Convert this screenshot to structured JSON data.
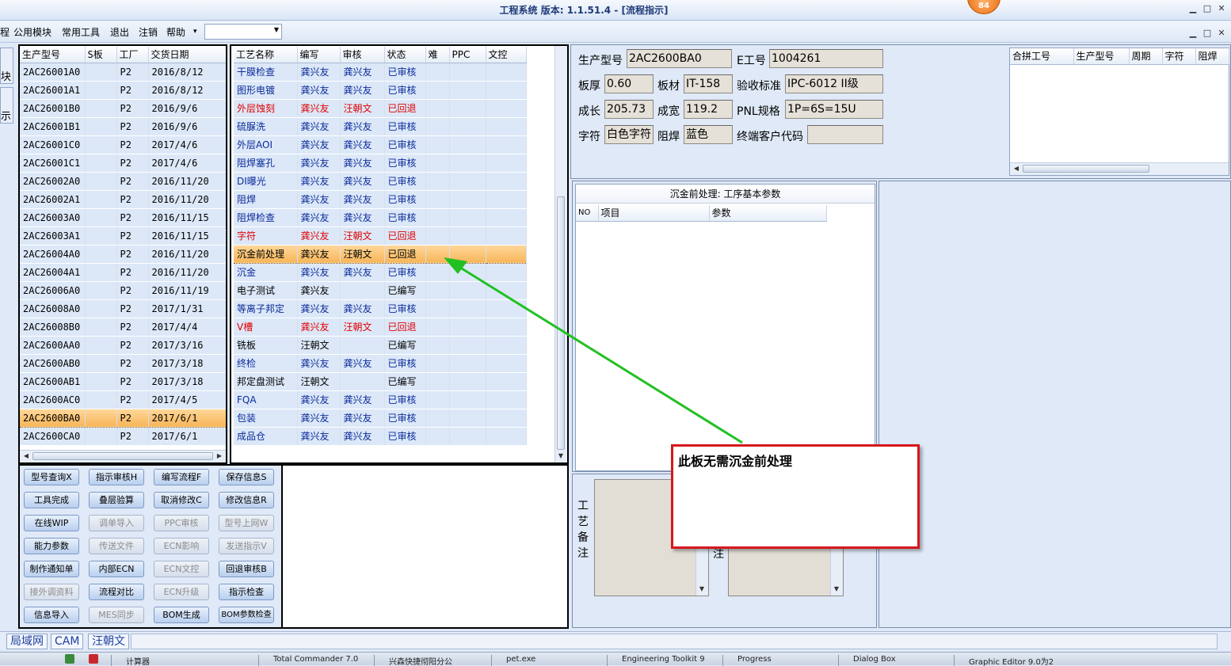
{
  "window": {
    "title": "工程系统  版本: 1.1.51.4 - [流程指示]",
    "badge": "84",
    "min_label": "▁",
    "max_label": "□",
    "close_label": "✕"
  },
  "menu": {
    "items": [
      "程",
      "公用模块",
      "常用工具",
      "退出",
      "注销",
      "帮助"
    ],
    "help_arrow": "▾"
  },
  "left_tabs": [
    "块",
    "示"
  ],
  "product_list": {
    "columns": [
      "生产型号",
      "S板",
      "工厂",
      "交货日期"
    ],
    "rows": [
      [
        "2AC26001A0",
        "",
        "P2",
        "2016/8/12"
      ],
      [
        "2AC26001A1",
        "",
        "P2",
        "2016/8/12"
      ],
      [
        "2AC26001B0",
        "",
        "P2",
        "2016/9/6"
      ],
      [
        "2AC26001B1",
        "",
        "P2",
        "2016/9/6"
      ],
      [
        "2AC26001C0",
        "",
        "P2",
        "2017/4/6"
      ],
      [
        "2AC26001C1",
        "",
        "P2",
        "2017/4/6"
      ],
      [
        "2AC26002A0",
        "",
        "P2",
        "2016/11/20"
      ],
      [
        "2AC26002A1",
        "",
        "P2",
        "2016/11/20"
      ],
      [
        "2AC26003A0",
        "",
        "P2",
        "2016/11/15"
      ],
      [
        "2AC26003A1",
        "",
        "P2",
        "2016/11/15"
      ],
      [
        "2AC26004A0",
        "",
        "P2",
        "2016/11/20"
      ],
      [
        "2AC26004A1",
        "",
        "P2",
        "2016/11/20"
      ],
      [
        "2AC26006A0",
        "",
        "P2",
        "2016/11/19"
      ],
      [
        "2AC26008A0",
        "",
        "P2",
        "2017/1/31"
      ],
      [
        "2AC26008B0",
        "",
        "P2",
        "2017/4/4"
      ],
      [
        "2AC2600AA0",
        "",
        "P2",
        "2017/3/16"
      ],
      [
        "2AC2600AB0",
        "",
        "P2",
        "2017/3/18"
      ],
      [
        "2AC2600AB1",
        "",
        "P2",
        "2017/3/18"
      ],
      [
        "2AC2600AC0",
        "",
        "P2",
        "2017/4/5"
      ],
      [
        "2AC2600BA0",
        "",
        "P2",
        "2017/6/1"
      ],
      [
        "2AC2600CA0",
        "",
        "P2",
        "2017/6/1"
      ]
    ],
    "selected_index": 19
  },
  "process_list": {
    "columns": [
      "工艺名称",
      "编写",
      "审核",
      "状态",
      "难",
      "PPC",
      "文控"
    ],
    "rows": [
      {
        "cells": [
          "干膜检查",
          "龚兴友",
          "龚兴友",
          "已审核",
          "",
          "",
          ""
        ],
        "color": "blue"
      },
      {
        "cells": [
          "图形电镀",
          "龚兴友",
          "龚兴友",
          "已审核",
          "",
          "",
          ""
        ],
        "color": "blue"
      },
      {
        "cells": [
          "外层蚀刻",
          "龚兴友",
          "汪朝文",
          "已回退",
          "",
          "",
          ""
        ],
        "color": "red"
      },
      {
        "cells": [
          "硫脲洗",
          "龚兴友",
          "龚兴友",
          "已审核",
          "",
          "",
          ""
        ],
        "color": "blue"
      },
      {
        "cells": [
          "外层AOI",
          "龚兴友",
          "龚兴友",
          "已审核",
          "",
          "",
          ""
        ],
        "color": "blue"
      },
      {
        "cells": [
          "阻焊塞孔",
          "龚兴友",
          "龚兴友",
          "已审核",
          "",
          "",
          ""
        ],
        "color": "blue"
      },
      {
        "cells": [
          "DI曝光",
          "龚兴友",
          "龚兴友",
          "已审核",
          "",
          "",
          ""
        ],
        "color": "blue"
      },
      {
        "cells": [
          "阻焊",
          "龚兴友",
          "龚兴友",
          "已审核",
          "",
          "",
          ""
        ],
        "color": "blue"
      },
      {
        "cells": [
          "阻焊检查",
          "龚兴友",
          "龚兴友",
          "已审核",
          "",
          "",
          ""
        ],
        "color": "blue"
      },
      {
        "cells": [
          "字符",
          "龚兴友",
          "汪朝文",
          "已回退",
          "",
          "",
          ""
        ],
        "color": "red"
      },
      {
        "cells": [
          "沉金前处理",
          "龚兴友",
          "汪朝文",
          "已回退",
          "",
          "",
          ""
        ],
        "color": "sel"
      },
      {
        "cells": [
          "沉金",
          "龚兴友",
          "龚兴友",
          "已审核",
          "",
          "",
          ""
        ],
        "color": "blue"
      },
      {
        "cells": [
          "电子测试",
          "龚兴友",
          "",
          "已编写",
          "",
          "",
          ""
        ],
        "color": "blk"
      },
      {
        "cells": [
          "等离子邦定",
          "龚兴友",
          "龚兴友",
          "已审核",
          "",
          "",
          ""
        ],
        "color": "blue"
      },
      {
        "cells": [
          "V槽",
          "龚兴友",
          "汪朝文",
          "已回退",
          "",
          "",
          ""
        ],
        "color": "red"
      },
      {
        "cells": [
          "铣板",
          "汪朝文",
          "",
          "已编写",
          "",
          "",
          ""
        ],
        "color": "blk"
      },
      {
        "cells": [
          "终检",
          "龚兴友",
          "龚兴友",
          "已审核",
          "",
          "",
          ""
        ],
        "color": "blue"
      },
      {
        "cells": [
          "邦定盘测试",
          "汪朝文",
          "",
          "已编写",
          "",
          "",
          ""
        ],
        "color": "blk"
      },
      {
        "cells": [
          "FQA",
          "龚兴友",
          "龚兴友",
          "已审核",
          "",
          "",
          ""
        ],
        "color": "blue"
      },
      {
        "cells": [
          "包装",
          "龚兴友",
          "龚兴友",
          "已审核",
          "",
          "",
          ""
        ],
        "color": "blue"
      },
      {
        "cells": [
          "成品仓",
          "龚兴友",
          "龚兴友",
          "已审核",
          "",
          "",
          ""
        ],
        "color": "blue"
      }
    ]
  },
  "buttons": [
    {
      "label": "型号查询X",
      "enabled": true
    },
    {
      "label": "指示审核H",
      "enabled": true
    },
    {
      "label": "编写流程F",
      "enabled": true
    },
    {
      "label": "保存信息S",
      "enabled": true
    },
    {
      "label": "工具完成",
      "enabled": true
    },
    {
      "label": "叠层验算",
      "enabled": true
    },
    {
      "label": "取消修改C",
      "enabled": true
    },
    {
      "label": "修改信息R",
      "enabled": true
    },
    {
      "label": "在线WIP",
      "enabled": true
    },
    {
      "label": "调单导入",
      "enabled": false
    },
    {
      "label": "PPC审核",
      "enabled": false
    },
    {
      "label": "型号上网W",
      "enabled": false
    },
    {
      "label": "能力参数",
      "enabled": true
    },
    {
      "label": "传送文件",
      "enabled": false
    },
    {
      "label": "ECN影响",
      "enabled": false
    },
    {
      "label": "发送指示V",
      "enabled": false
    },
    {
      "label": "制作通知单",
      "enabled": true
    },
    {
      "label": "内部ECN",
      "enabled": true
    },
    {
      "label": "ECN文控",
      "enabled": false
    },
    {
      "label": "回退审核B",
      "enabled": true
    },
    {
      "label": "接外调资料",
      "enabled": false
    },
    {
      "label": "流程对比",
      "enabled": true
    },
    {
      "label": "ECN升级",
      "enabled": false
    },
    {
      "label": "指示检查",
      "enabled": true
    },
    {
      "label": "信息导入",
      "enabled": true
    },
    {
      "label": "MES同步",
      "enabled": false
    },
    {
      "label": "BOM生成",
      "enabled": true
    },
    {
      "label": "BOM参数检查",
      "enabled": true
    }
  ],
  "info": {
    "model_label": "生产型号",
    "model_value": "2AC2600BA0",
    "eno_label": "E工号",
    "eno_value": "1004261",
    "thick_label": "板厚",
    "thick_value": "0.60",
    "material_label": "板材",
    "material_value": "IT-158",
    "standard_label": "验收标准",
    "standard_value": "IPC-6012 II级",
    "length_label": "成长",
    "length_value": "205.73",
    "width_label": "成宽",
    "width_value": "119.2",
    "pnl_label": "PNL规格",
    "pnl_value": "1P=6S=15U",
    "char_label": "字符",
    "char_value": "白色字符",
    "mask_label": "阻焊",
    "mask_value": "蓝色",
    "customer_label": "终端客户代码",
    "customer_value": ""
  },
  "merge_grid": {
    "columns": [
      "合拼工号",
      "生产型号",
      "周期",
      "字符",
      "阻焊"
    ]
  },
  "param_panel": {
    "title": "沉金前处理: 工序基本参数",
    "columns": [
      "NO",
      "项目",
      "参数"
    ]
  },
  "remarks": {
    "process_note_label": "工艺备注",
    "other_note_label": "注"
  },
  "callout": {
    "text": "此板无需沉金前处理"
  },
  "status_tabs": [
    "局域网",
    "CAM",
    "汪朝文"
  ],
  "taskbar": [
    "计算器",
    "Total Commander 7.0",
    "兴森快捷彻阳分公",
    "pet.exe",
    "Engineering Toolkit 9",
    "Progress",
    "Dialog Box",
    "Graphic Editor 9.0为2"
  ],
  "colors": {
    "accent": "#1f3a78",
    "selected_row": "#f7b55a",
    "rollback_red": "#e00000",
    "approved_blue": "#0a2a9a",
    "callout_border": "#d6181e",
    "arrow_green": "#22c022"
  }
}
